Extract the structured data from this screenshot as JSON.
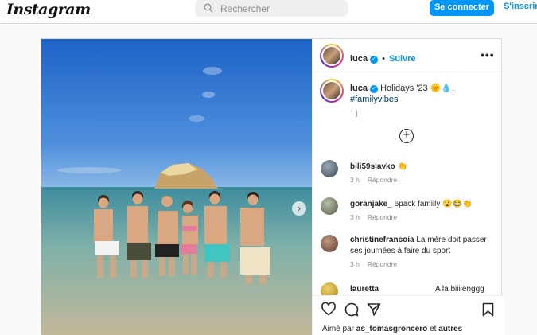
{
  "header": {
    "logo": "Instagram",
    "search_placeholder": "Rechercher",
    "login_label": "Se connecter",
    "signup_label": "S'inscrire"
  },
  "post": {
    "username": "luca",
    "follow_label": "Suivre",
    "more_label": "•••",
    "caption": "Holidays '23 🌞💧.",
    "hashtag": "#familyvibes",
    "time": "1 j",
    "likes_prefix": "Aimé par",
    "likes_user": "as_tomasgroncero",
    "likes_and": "et",
    "likes_others": "autres"
  },
  "comments": [
    {
      "user": "bili59slavko",
      "text": "👏",
      "time": "3 h",
      "reply": "Répondre"
    },
    {
      "user": "goranjake_",
      "text": "6pack familly 😮😂👏",
      "time": "3 h",
      "reply": "Répondre"
    },
    {
      "user": "christinefrancoia",
      "text": "La mère doit passer ses journées à faire du sport",
      "time": "3 h",
      "reply": "Répondre"
    },
    {
      "user": "lauretta",
      "text": "A la biiiienggg"
    }
  ],
  "icons": [
    "search-icon",
    "verified-icon",
    "more-icon",
    "add-comment-icon",
    "heart-icon",
    "comment-icon",
    "share-icon",
    "bookmark-icon",
    "chevron-right-icon"
  ],
  "colors": {
    "accent": "#0095f6",
    "text": "#262626",
    "muted": "#8e8e8e"
  }
}
